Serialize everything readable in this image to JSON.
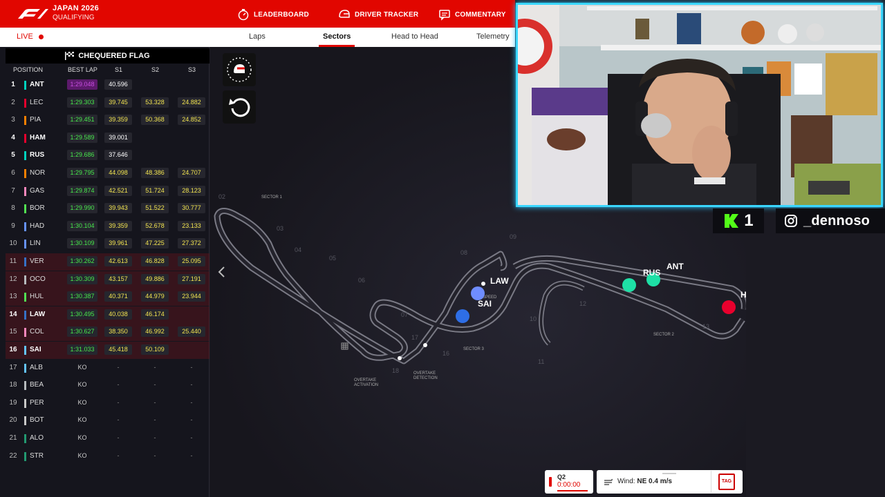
{
  "header": {
    "event_title": "JAPAN 2026",
    "session": "QUALIFYING",
    "nav": [
      {
        "label": "LEADERBOARD",
        "icon": "stopwatch-icon"
      },
      {
        "label": "DRIVER TRACKER",
        "icon": "helmet-icon"
      },
      {
        "label": "COMMENTARY",
        "icon": "chat-icon"
      }
    ]
  },
  "subnav": {
    "live": "LIVE",
    "tabs": [
      "Laps",
      "Sectors",
      "Head to Head",
      "Telemetry"
    ],
    "active_tab": "Sectors"
  },
  "leaderboard": {
    "flag_title": "CHEQUERED FLAG",
    "columns": [
      "POSITION",
      "BEST LAP",
      "S1",
      "S2",
      "S3"
    ],
    "rows": [
      {
        "pos": "1",
        "driver": "ANT",
        "team_color": "#00d2be",
        "best": "1:29.048",
        "s1": "40.596",
        "s2": "",
        "s3": "",
        "hi": true,
        "purple": true
      },
      {
        "pos": "2",
        "driver": "LEC",
        "team_color": "#e8002d",
        "best": "1:29.303",
        "s1": "39.745",
        "s2": "53.328",
        "s3": "24.882"
      },
      {
        "pos": "3",
        "driver": "PIA",
        "team_color": "#ff8000",
        "best": "1:29.451",
        "s1": "39.359",
        "s2": "50.368",
        "s3": "24.852"
      },
      {
        "pos": "4",
        "driver": "HAM",
        "team_color": "#e8002d",
        "best": "1:29.589",
        "s1": "39.001",
        "s2": "",
        "s3": "",
        "hi": true
      },
      {
        "pos": "5",
        "driver": "RUS",
        "team_color": "#00d2be",
        "best": "1:29.686",
        "s1": "37.646",
        "s2": "",
        "s3": "",
        "hi": true
      },
      {
        "pos": "6",
        "driver": "NOR",
        "team_color": "#ff8000",
        "best": "1:29.795",
        "s1": "44.098",
        "s2": "48.386",
        "s3": "24.707"
      },
      {
        "pos": "7",
        "driver": "GAS",
        "team_color": "#ff87bc",
        "best": "1:29.874",
        "s1": "42.521",
        "s2": "51.724",
        "s3": "28.123"
      },
      {
        "pos": "8",
        "driver": "BOR",
        "team_color": "#52e252",
        "best": "1:29.990",
        "s1": "39.943",
        "s2": "51.522",
        "s3": "30.777"
      },
      {
        "pos": "9",
        "driver": "HAD",
        "team_color": "#6692ff",
        "best": "1:30.104",
        "s1": "39.359",
        "s2": "52.678",
        "s3": "23.133"
      },
      {
        "pos": "10",
        "driver": "LIN",
        "team_color": "#6692ff",
        "best": "1:30.109",
        "s1": "39.961",
        "s2": "47.225",
        "s3": "27.372"
      },
      {
        "pos": "11",
        "driver": "VER",
        "team_color": "#3671c6",
        "best": "1:30.262",
        "s1": "42.613",
        "s2": "46.828",
        "s3": "25.095",
        "ko": true
      },
      {
        "pos": "12",
        "driver": "OCO",
        "team_color": "#b6babd",
        "best": "1:30.309",
        "s1": "43.157",
        "s2": "49.886",
        "s3": "27.191",
        "ko": true
      },
      {
        "pos": "13",
        "driver": "HUL",
        "team_color": "#52e252",
        "best": "1:30.387",
        "s1": "40.371",
        "s2": "44.979",
        "s3": "23.944",
        "ko": true
      },
      {
        "pos": "14",
        "driver": "LAW",
        "team_color": "#3671c6",
        "best": "1:30.495",
        "s1": "40.038",
        "s2": "46.174",
        "s3": "",
        "ko": true,
        "hi": true
      },
      {
        "pos": "15",
        "driver": "COL",
        "team_color": "#ff87bc",
        "best": "1:30.627",
        "s1": "38.350",
        "s2": "46.992",
        "s3": "25.440",
        "ko": true
      },
      {
        "pos": "16",
        "driver": "SAI",
        "team_color": "#64c4ff",
        "best": "1:31.033",
        "s1": "45.418",
        "s2": "50.109",
        "s3": "",
        "ko": true,
        "hi": true
      },
      {
        "pos": "17",
        "driver": "ALB",
        "team_color": "#64c4ff",
        "best": "KO",
        "s1": "-",
        "s2": "-",
        "s3": "-",
        "out": true
      },
      {
        "pos": "18",
        "driver": "BEA",
        "team_color": "#b6babd",
        "best": "KO",
        "s1": "-",
        "s2": "-",
        "s3": "-",
        "out": true
      },
      {
        "pos": "19",
        "driver": "PER",
        "team_color": "#c8c8c8",
        "best": "KO",
        "s1": "-",
        "s2": "-",
        "s3": "-",
        "out": true
      },
      {
        "pos": "20",
        "driver": "BOT",
        "team_color": "#c8c8c8",
        "best": "KO",
        "s1": "-",
        "s2": "-",
        "s3": "-",
        "out": true
      },
      {
        "pos": "21",
        "driver": "ALO",
        "team_color": "#229971",
        "best": "KO",
        "s1": "-",
        "s2": "-",
        "s3": "-",
        "out": true
      },
      {
        "pos": "22",
        "driver": "STR",
        "team_color": "#229971",
        "best": "KO",
        "s1": "-",
        "s2": "-",
        "s3": "-",
        "out": true
      }
    ]
  },
  "map": {
    "sector_labels": [
      "SECTOR 1",
      "SECTOR 2",
      "SECTOR 3"
    ],
    "overtake_activation": [
      "OVERTAKE",
      "ACTIVATION"
    ],
    "overtake_detection": [
      "OVERTAKE",
      "DETECTION"
    ],
    "turns": [
      "02",
      "03",
      "04",
      "05",
      "06",
      "07",
      "08",
      "09",
      "10",
      "11",
      "12",
      "13",
      "16",
      "17",
      "18"
    ],
    "car_labels": [
      "LAW",
      "SAI",
      "ANT",
      "RUS",
      "H"
    ],
    "speed_trap": "SPEED",
    "session_badge": "Q2",
    "session_time": "0:00:00",
    "wind_label": "Wind:",
    "wind_value": "NE 0.4 m/s",
    "sponsor": "TAG"
  },
  "stream": {
    "channel_badge": "1",
    "handle": "_dennoso"
  }
}
